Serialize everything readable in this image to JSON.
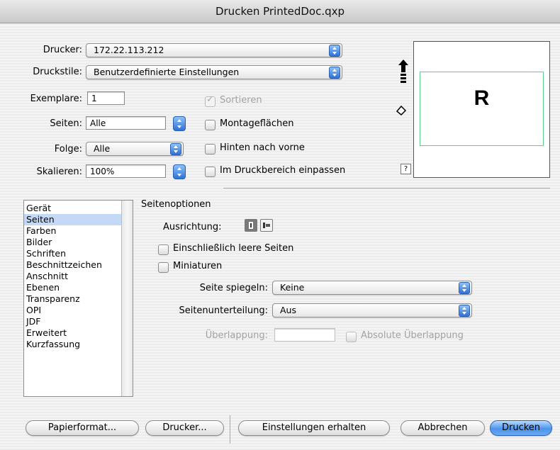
{
  "window": {
    "title": "Drucken PrintedDoc.qxp"
  },
  "printer": {
    "label": "Drucker:",
    "value": "172.22.113.212"
  },
  "print_style": {
    "label": "Druckstile:",
    "value": "Benutzerdefinierte Einstellungen"
  },
  "copies": {
    "label": "Exemplare:",
    "value": "1"
  },
  "pages": {
    "label": "Seiten:",
    "value": "Alle"
  },
  "sequence": {
    "label": "Folge:",
    "value": "Alle"
  },
  "scale": {
    "label": "Skalieren:",
    "value": "100%"
  },
  "options": {
    "collate": {
      "label": "Sortieren",
      "checked": true,
      "enabled": false
    },
    "spreads": {
      "label": "Montageflächen",
      "checked": false
    },
    "back_to_front": {
      "label": "Hinten nach vorne",
      "checked": false
    },
    "fit_in_print_area": {
      "label": "Im Druckbereich einpassen",
      "checked": false
    }
  },
  "preview": {
    "letter": "R",
    "help": "?"
  },
  "categories": {
    "items": [
      "Gerät",
      "Seiten",
      "Farben",
      "Bilder",
      "Schriften",
      "Beschnittzeichen",
      "Anschnitt",
      "Ebenen",
      "Transparenz",
      "OPI",
      "JDF",
      "Erweitert",
      "Kurzfassung"
    ],
    "selected": "Seiten"
  },
  "page_options": {
    "section_title": "Seitenoptionen",
    "orientation_label": "Ausrichtung:",
    "include_blank": {
      "label": "Einschließlich leere Seiten",
      "checked": false
    },
    "thumbnails": {
      "label": "Miniaturen",
      "checked": false
    },
    "flip_label": "Seite spiegeln:",
    "flip_value": "Keine",
    "tiling_label": "Seitenunterteilung:",
    "tiling_value": "Aus",
    "overlap_label": "Überlappung:",
    "overlap_value": "",
    "absolute_overlap": {
      "label": "Absolute Überlappung",
      "checked": false,
      "enabled": false
    }
  },
  "buttons": {
    "page_setup": "Papierformat...",
    "printer": "Drucker...",
    "capture_settings": "Einstellungen erhalten",
    "cancel": "Abbrechen",
    "print": "Drucken"
  },
  "colors": {
    "accent": "#3f86e6",
    "selection": "#c4d9f6",
    "preview_border": "#5cd08a"
  }
}
